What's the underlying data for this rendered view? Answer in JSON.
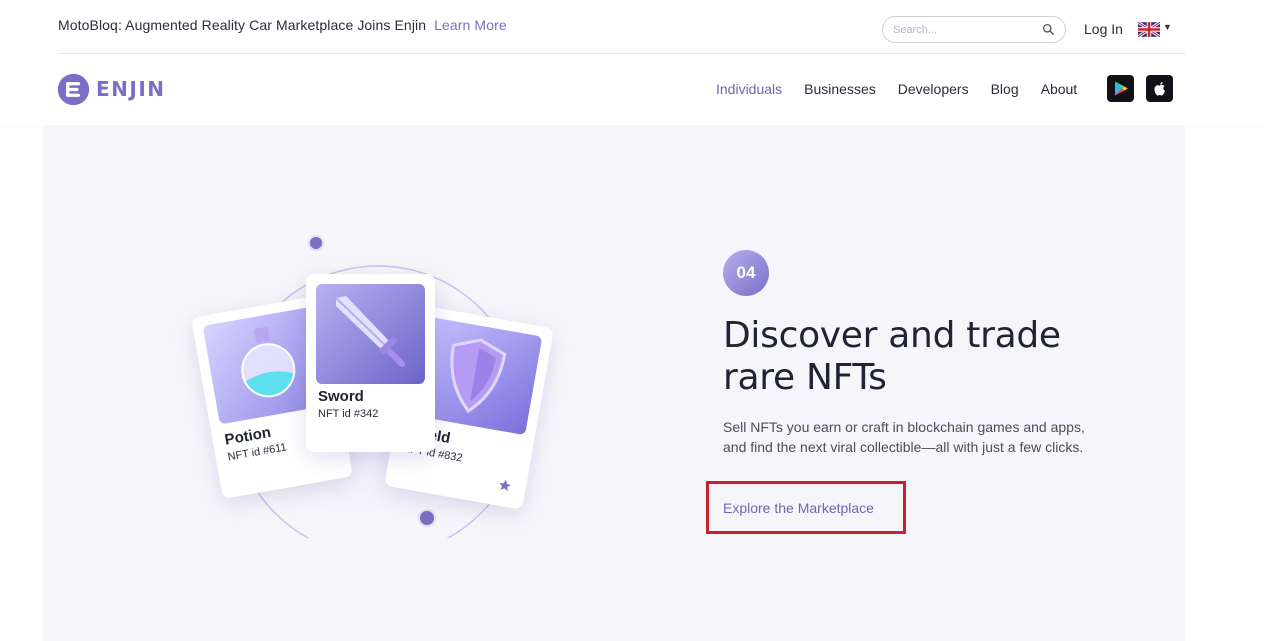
{
  "announcement": {
    "text": "MotoBloq: Augmented Reality Car Marketplace Joins Enjin",
    "link": "Learn More"
  },
  "search": {
    "placeholder": "Search..."
  },
  "login": "Log In",
  "language": {
    "icon": "uk-flag-icon"
  },
  "brand": {
    "name": "ENJIN",
    "color": "#7b6fc4"
  },
  "nav": {
    "items": [
      "Individuals",
      "Businesses",
      "Developers",
      "Blog",
      "About"
    ],
    "active": "Individuals"
  },
  "stores": [
    "google-play-icon",
    "apple-icon"
  ],
  "hero": {
    "step": "04",
    "title": "Discover and trade rare NFTs",
    "description": "Sell NFTs you earn or craft in blockchain games and apps, and find the next viral collectible—all with just a few clicks.",
    "cta": "Explore the Marketplace",
    "highlight_color": "#c8212b"
  },
  "cards": [
    {
      "title": "Potion",
      "id": "NFT id #611"
    },
    {
      "title": "Sword",
      "id": "NFT id #342"
    },
    {
      "title": "Shield",
      "id": "NFT id #832"
    }
  ]
}
